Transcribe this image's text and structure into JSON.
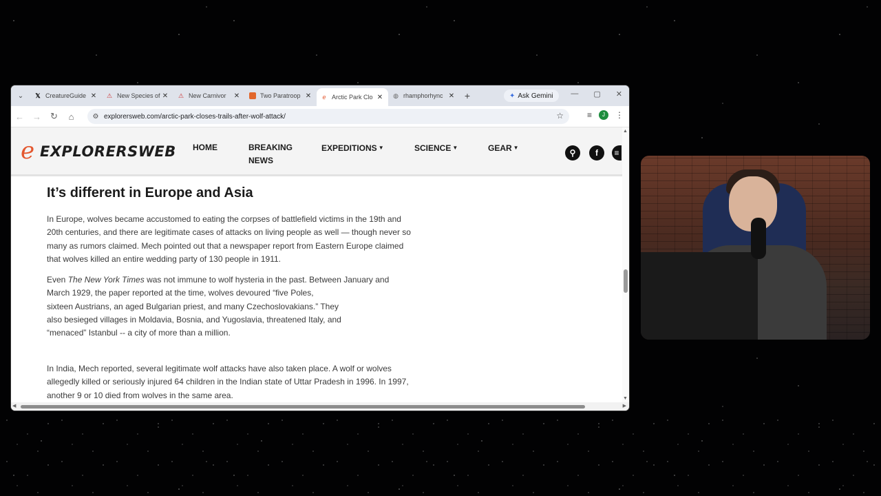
{
  "browser": {
    "tabs": [
      {
        "title": "CreatureGuide",
        "icon": "x-logo-icon",
        "active": false
      },
      {
        "title": "New Species of",
        "icon": "news-favicon-icon",
        "active": false
      },
      {
        "title": "New Carnivor",
        "icon": "news-favicon-icon",
        "active": false
      },
      {
        "title": "Two Paratroop",
        "icon": "news-favicon-icon",
        "active": false
      },
      {
        "title": "Arctic Park Clo",
        "icon": "explorersweb-favicon-icon",
        "active": true
      },
      {
        "title": "rhamphorhync",
        "icon": "globe-icon",
        "active": false
      }
    ],
    "gemini_label": "Ask Gemini",
    "url": "explorersweb.com/arctic-park-closes-trails-after-wolf-attack/",
    "profile_initial": "J"
  },
  "site": {
    "logo_text": "EXPLORERSWEB",
    "nav": {
      "home": "HOME",
      "breaking_1": "BREAKING",
      "breaking_2": "NEWS",
      "expeditions": "EXPEDITIONS",
      "science": "SCIENCE",
      "gear": "GEAR"
    }
  },
  "article": {
    "heading": "It’s different in Europe and Asia",
    "p1_lines": [
      "In Europe, wolves became accustomed to eating the corpses of battlefield victims in the 19th and",
      "20th centuries, and there are legitimate cases of attacks on living people as well — though never so",
      "many as rumors claimed. Mech pointed out that a newspaper report from Eastern Europe claimed",
      "that wolves killed an entire wedding party of 130 people in 1911."
    ],
    "p2_even": "Even ",
    "p2_nyt": "The New York Times",
    "p2_rest": " was not immune to wolf hysteria in the past. Between January and",
    "p2_lines": [
      "March 1929, the paper reported at the time, wolves devoured “five Poles,",
      "sixteen Austrians, an aged Bulgarian priest, and many Czechoslovakians.” They",
      "also besieged villages in Moldavia, Bosnia, and Yugoslavia, threatened Italy, and",
      "“menaced” Istanbul -- a city of more than a million."
    ],
    "p3_lines": [
      "In India, Mech reported, several legitimate wolf attacks have also taken place. A wolf or wolves",
      "allegedly killed or seriously injured 64 children in the Indian state of Uttar Pradesh in 1996. In 1997,",
      "another 9 or 10 died from wolves in the same area."
    ]
  },
  "colors": {
    "brand_orange": "#e4572e",
    "tabbar_bg": "#dfe3eb"
  }
}
